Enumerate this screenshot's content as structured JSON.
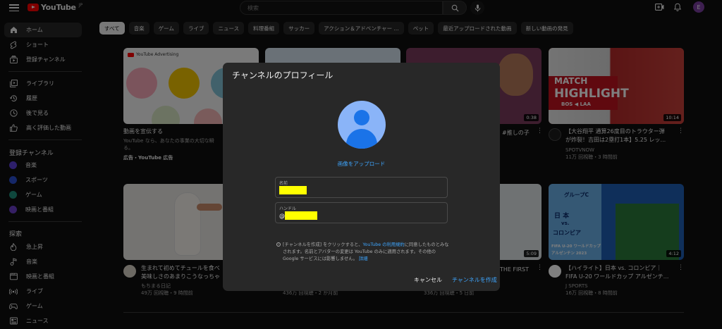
{
  "header": {
    "logo_text": "YouTube",
    "logo_region": "JP",
    "search_placeholder": "検索",
    "avatar_letter": "E"
  },
  "sidebar": {
    "main": [
      {
        "label": "ホーム",
        "icon": "home-icon"
      },
      {
        "label": "ショート",
        "icon": "shorts-icon"
      },
      {
        "label": "登録チャンネル",
        "icon": "subscriptions-icon"
      }
    ],
    "library": [
      {
        "label": "ライブラリ",
        "icon": "library-icon"
      },
      {
        "label": "履歴",
        "icon": "history-icon"
      },
      {
        "label": "後で見る",
        "icon": "watch-later-icon"
      },
      {
        "label": "高く評価した動画",
        "icon": "like-icon"
      }
    ],
    "subs_heading": "登録チャンネル",
    "subs": [
      {
        "label": "音楽",
        "color": "#5b3fd6"
      },
      {
        "label": "スポーツ",
        "color": "#2a4fd0"
      },
      {
        "label": "ゲーム",
        "color": "#1f8f7a"
      },
      {
        "label": "映画と番組",
        "color": "#6a3fc8"
      }
    ],
    "explore_heading": "探索",
    "explore": [
      {
        "label": "急上昇",
        "icon": "fire-icon"
      },
      {
        "label": "音楽",
        "icon": "music-icon"
      },
      {
        "label": "映画と番組",
        "icon": "film-icon"
      },
      {
        "label": "ライブ",
        "icon": "live-icon"
      },
      {
        "label": "ゲーム",
        "icon": "gamepad-icon"
      },
      {
        "label": "ニュース",
        "icon": "news-icon"
      }
    ]
  },
  "chips": [
    "すべて",
    "音楽",
    "ゲーム",
    "ライブ",
    "ニュース",
    "料理番組",
    "サッカー",
    "アクション＆アドベンチャー ...",
    "ペット",
    "最近アップロードされた動画",
    "新しい動画の発見"
  ],
  "videos": {
    "ad": {
      "brand": "YouTube Advertising",
      "title": "動画を宣伝する",
      "desc": "YouTube なら、あなたの事業の大切な瞬",
      "desc2": "る。",
      "sponsor": "広告・YouTube 広告"
    },
    "v3": {
      "duration": "0:38",
      "title_tail": "#推しの子"
    },
    "v4": {
      "duration": "10:14",
      "title1": "【大谷翔平 通算26度目のトラウター弾",
      "title2": "が炸裂！吉田は2塁打1本】5.25 レッ...",
      "channel": "SPOTVNOW",
      "meta": "11万 回視聴・3 時間前",
      "thumb_line1": "MATCH",
      "thumb_line2": "HIGHLIGHT",
      "thumb_score": "BOS  ◀  LAA"
    },
    "v5": {
      "title1": "生まれて初めてチュールを食べ",
      "title2": "美味しさのあまりこうなっちゃ",
      "channel": "もちまる日記",
      "meta": "49万 回視聴・9 時間前"
    },
    "v6": {
      "meta": "436万 回視聴・2 か月前"
    },
    "v7": {
      "duration": "5:09",
      "title_tail": "THE FIRST",
      "meta": "336万 回視聴・5 日前"
    },
    "v8": {
      "duration": "4:12",
      "title1": "【ハイライト】日本 vs. コロンビア｜",
      "title2": "FIFA U-20 ワールドカップ アルゼンチ...",
      "channel": "J SPORTS",
      "meta": "16万 回視聴・8 時間前",
      "thumb_group": "グループC",
      "thumb_team1": "日 本",
      "thumb_vs": "vs.",
      "thumb_team2": "コロンビア",
      "thumb_event1": "FIFA U-20 ワールドカップ",
      "thumb_event2": "アルゼンチン 2023"
    }
  },
  "dialog": {
    "title": "チャンネルのプロフィール",
    "upload": "画像をアップロード",
    "name_label": "名前",
    "handle_label": "ハンドル",
    "handle_prefix": "@",
    "notice_a": "[チャンネルを作成] をクリックすると、",
    "notice_link": "YouTube の利用規約",
    "notice_b": "に同意したものとみなされます。名前とアバターの変更は YouTube のみに適用されます。その他の Google サービスには影響しません。",
    "notice_more": "詳細",
    "cancel": "キャンセル",
    "create": "チャンネルを作成"
  }
}
